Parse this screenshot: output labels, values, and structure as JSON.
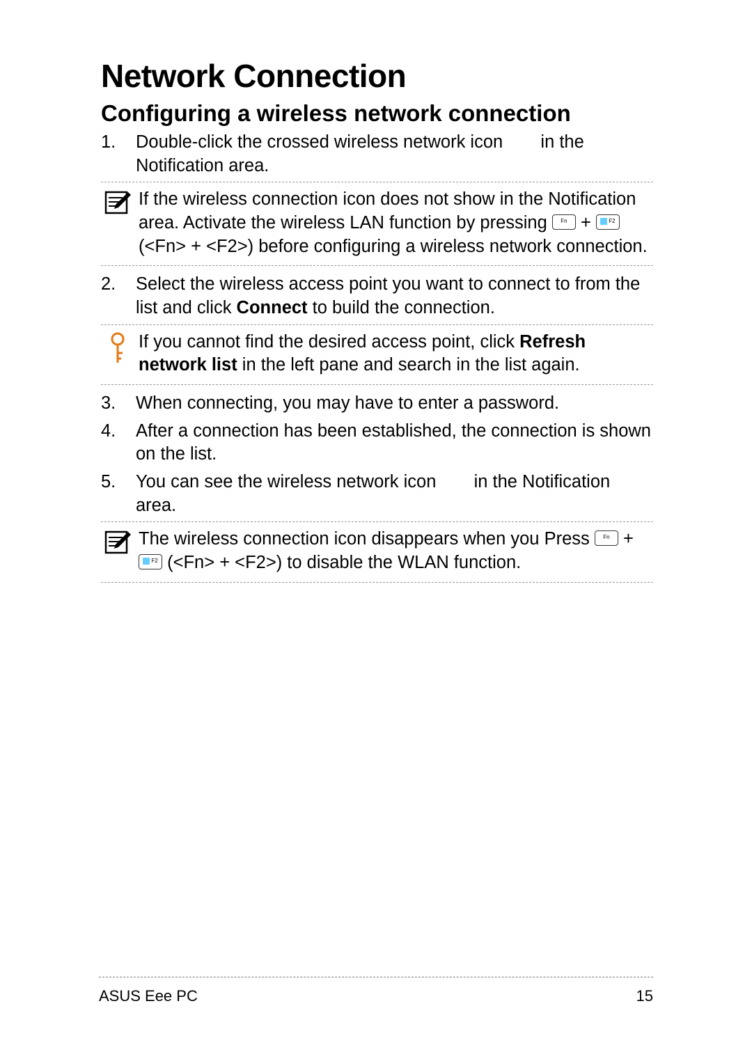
{
  "title": "Network Connection",
  "subtitle": "Configuring a wireless network connection",
  "steps": {
    "s1_num": "1.",
    "s1_a": "Double-click the crossed wireless network icon",
    "s1_b": "in the Notification area.",
    "s2_num": "2.",
    "s2_a": "Select the wireless access point you want to connect to from the list and click ",
    "s2_bold": "Connect",
    "s2_b": " to build the connection.",
    "s3_num": "3.",
    "s3": "When connecting, you may have to enter a password.",
    "s4_num": "4.",
    "s4": "After a connection has been established, the connection is shown on the list.",
    "s5_num": "5.",
    "s5_a": "You can see the wireless network icon",
    "s5_b": "in the Notification area."
  },
  "notes": {
    "n1_a": "If the wireless connection icon does not show in the Notification area. Activate the wireless LAN function by pressing ",
    "n1_b": " + ",
    "n1_c": " (<Fn> + <F2>) before configuring a wireless network connection.",
    "n2_a": "If you cannot find the desired access point, click ",
    "n2_bold1": "Refresh network list",
    "n2_b": " in the left pane and search in the list again.",
    "n3_a": "The wireless connection icon disappears when you Press ",
    "n3_b": " + ",
    "n3_c": " (<Fn> + <F2>) to disable the WLAN function."
  },
  "keys": {
    "fn": "Fn",
    "f2": "F2"
  },
  "footer": {
    "left": "ASUS Eee PC",
    "right": "15"
  }
}
